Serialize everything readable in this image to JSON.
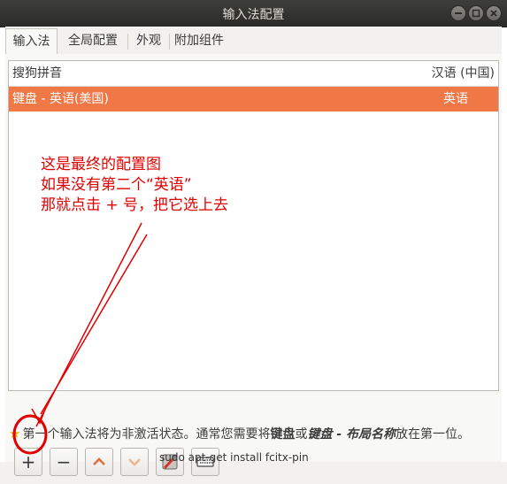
{
  "window": {
    "title": "输入法配置"
  },
  "tabs": [
    {
      "label": "输入法"
    },
    {
      "label": "全局配置"
    },
    {
      "label": "外观"
    },
    {
      "label": "附加组件"
    }
  ],
  "list": {
    "header": {
      "name": "搜狗拼音",
      "language": "汉语 (中国)"
    },
    "selected_row": {
      "name": "键盘 - 英语(美国)",
      "language": "英语"
    }
  },
  "annotation": {
    "lines": [
      "这是最终的配置图",
      "如果没有第二个“英语”",
      "那就点击    +  号，把它选上去"
    ]
  },
  "info": {
    "prefix": "第一个输入法将为非激活状态。通常您需要将",
    "bold1": "键盘",
    "mid": "或",
    "bold2": "键盘 - 布局名称",
    "suffix": "放在第一位。"
  },
  "toolbar": {
    "add_label": "+",
    "remove_label": "−",
    "up_label": "︿",
    "down_label": "﹀"
  },
  "background": {
    "bottom_text": "sudo apt-get install fcitx-pin"
  },
  "colors": {
    "selection": "#f07746",
    "annotation": "#e00000",
    "titlebar": "#3d3d3a"
  },
  "icons": {
    "star": "star-icon",
    "config": "configure-icon",
    "keyboard": "keyboard-icon"
  }
}
